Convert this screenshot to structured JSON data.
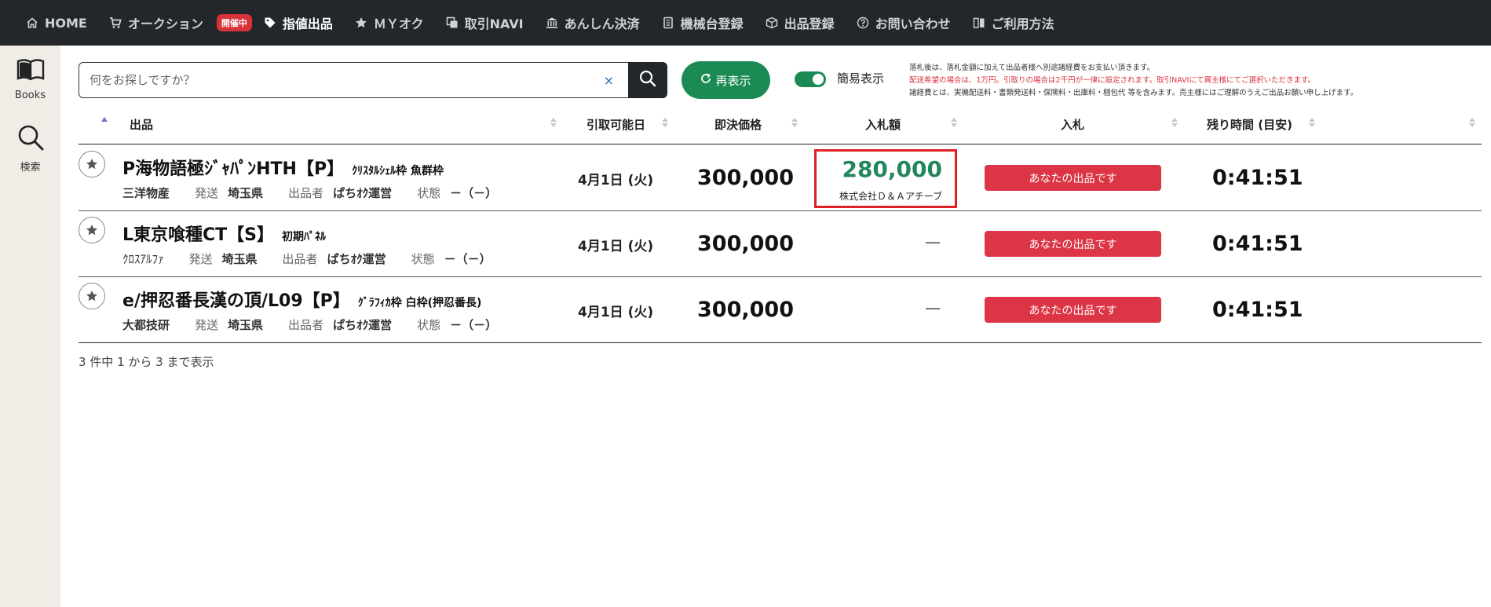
{
  "nav": {
    "home": "HOME",
    "auction": "オークション",
    "auction_badge": "開催中",
    "listing": "指値出品",
    "myoku": "ＭＹオク",
    "navi": "取引NAVI",
    "anshin": "あんしん決済",
    "machine": "機械台登録",
    "exhibit": "出品登録",
    "contact": "お問い合わせ",
    "howto": "ご利用方法"
  },
  "sidebar": {
    "books": "Books",
    "search": "検索"
  },
  "search": {
    "placeholder": "何をお探しですか？",
    "clear": "×"
  },
  "toolbar": {
    "refresh": "再表示",
    "simple_view": "簡易表示",
    "simple_view_on": true
  },
  "notice": {
    "line1": "落札後は、落札金額に加えて出品者様へ別途諸経費をお支払い頂きます。",
    "line2": "配送希望の場合は、1万円。引取りの場合は2千円が一律に設定されます。取引NAVIにて買主様にてご選択いただきます。",
    "line3": "諸経費とは、実機配送料・書類発送料・保険料・出庫料・梱包代 等を含みます。売主様にはご理解のうえご出品お願い申し上げます。"
  },
  "table": {
    "headers": {
      "item": "出品",
      "pickup": "引取可能日",
      "buyout": "即決価格",
      "bid_amount": "入札額",
      "bid": "入札",
      "remaining": "残り時間 (目安)"
    },
    "labels": {
      "ship": "発送",
      "seller": "出品者",
      "condition": "状態"
    },
    "rows": [
      {
        "title": "P海物語極ｼﾞｬﾊﾟﾝHTH【P】",
        "subtitle": "ｸﾘｽﾀﾙｼｪﾙ枠 魚群枠",
        "maker": "三洋物産",
        "ship": "埼玉県",
        "seller": "ぱちｵｸ運営",
        "condition": "－（－）",
        "pickup": "4月1日 (火)",
        "buyout": "300,000",
        "bid_amount": "280,000",
        "bidder": "株式会社Ｄ＆Ａアチーブ",
        "bid_button": "あなたの出品です",
        "remaining": "0:41:51"
      },
      {
        "title": "L東京喰種CT【S】",
        "subtitle": "初期ﾊﾟﾈﾙ",
        "maker": "ｸﾛｽｱﾙﾌｧ",
        "ship": "埼玉県",
        "seller": "ぱちｵｸ運営",
        "condition": "－（－）",
        "pickup": "4月1日 (火)",
        "buyout": "300,000",
        "bid_amount": "—",
        "bid_button": "あなたの出品です",
        "remaining": "0:41:51"
      },
      {
        "title": "e/押忍番長漢の頂/L09【P】",
        "subtitle": "ｸﾞﾗﾌｨｶ枠 白枠(押忍番長)",
        "maker": "大都技研",
        "ship": "埼玉県",
        "seller": "ぱちｵｸ運営",
        "condition": "－（－）",
        "pickup": "4月1日 (火)",
        "buyout": "300,000",
        "bid_amount": "—",
        "bid_button": "あなたの出品です",
        "remaining": "0:41:51"
      }
    ],
    "count_text": "3 件中 1 から 3 まで表示"
  },
  "colors": {
    "nav_bg": "#23272b",
    "sidebar_bg": "#efede6",
    "accent_green": "#1b8a53",
    "bid_green": "#22875a",
    "button_red": "#dc3545",
    "highlight_red": "#e01f26"
  },
  "icons": {
    "home": "home-icon",
    "auction": "cart-icon",
    "listing": "tag-icon",
    "myoku": "star-icon",
    "navi": "copy-icon",
    "anshin": "bank-icon",
    "machine": "notebook-icon",
    "exhibit": "box-icon",
    "contact": "question-circle-icon",
    "howto": "book-icon",
    "books": "open-book-icon",
    "search": "search-icon",
    "refresh": "refresh-icon",
    "favorite": "star-icon"
  }
}
